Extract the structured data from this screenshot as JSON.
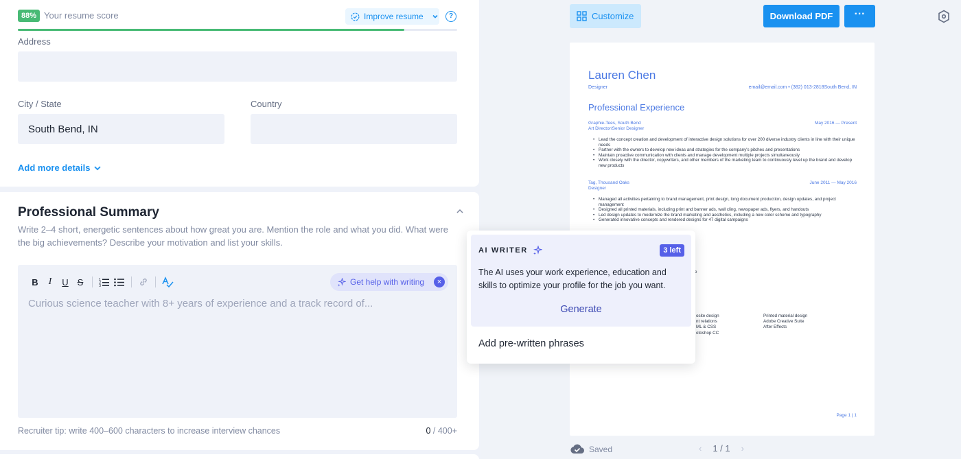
{
  "score": {
    "badge": "88%",
    "label": "Your resume score",
    "progress_percent": 88,
    "improve_label": "Improve resume",
    "help_glyph": "?"
  },
  "personal": {
    "address_label": "Address",
    "address_value": "",
    "city_label": "City / State",
    "city_value": "South Bend, IN",
    "country_label": "Country",
    "country_value": "",
    "add_more_label": "Add more details"
  },
  "summary": {
    "title": "Professional Summary",
    "description": "Write 2–4 short, energetic sentences about how great you are. Mention the role and what you did. What were the big achievements? Describe your motivation and list your skills.",
    "toolbar": {
      "bold": "B",
      "italic": "I",
      "underline": "U",
      "strike": "S"
    },
    "help_writing_label": "Get help with writing",
    "help_close_glyph": "×",
    "placeholder": "Curious science teacher with 8+ years of experience and a track record of...",
    "tip": "Recruiter tip: write 400–600 characters to increase interview chances",
    "count_current": "0",
    "count_max": " / 400+"
  },
  "preview_toolbar": {
    "customize_label": "Customize",
    "download_label": "Download PDF",
    "more_glyph": "···"
  },
  "resume": {
    "name": "Lauren Chen",
    "role": "Designer",
    "contact": "email@email.com • (382) 013-2818South Bend, IN",
    "section_experience": "Professional Experience",
    "jobs": [
      {
        "company": "Graphie-Tees, South Bend",
        "title": "Art Director/Senior Designer",
        "dates": "May 2016 — Present",
        "bullets": [
          "Lead the concept creation and development of interactive design solutions for over 200 diverse industry clients in line with their unique needs",
          "Partner with the owners to develop new ideas and strategies for the company's pitches and presentations",
          "Maintain proactive communication with clients and manage development multiple projects simultaneously",
          "Work closely with the director, copywriters, and other members of the marketing team to continuously level up the brand and develop new products"
        ]
      },
      {
        "company": "Tag, Thousand Oaks",
        "title": "Designer",
        "dates": "June 2011 — May 2016",
        "bullets": [
          "Managed all activities pertaining to brand management, print design, long document production, design updates, and project management",
          "Designed all printed materials, including print and banner ads, wall cling, newspaper ads, flyers, and handouts",
          "Led design updates to modernize the brand marketing and aesthetics, including a new color scheme and typography",
          "Generated innovative concepts and rendered designs for 47 digital campaigns"
        ]
      }
    ],
    "partial_fragment": "e",
    "skills_col1": [
      "osite design",
      "nt relations",
      "ML & CSS",
      "otoshop CC"
    ],
    "skills_col2": [
      "Printed material design",
      "Adobe Creative Suite",
      "After Effects"
    ],
    "page_label": "Page 1 | 1"
  },
  "footer": {
    "saved_label": "Saved",
    "page_indicator": "1 / 1",
    "prev_glyph": "‹",
    "next_glyph": "›"
  },
  "ai_popup": {
    "title": "AI WRITER",
    "badge": "3 left",
    "text": "The AI uses your work experience, education and skills to optimize your profile for the job you want.",
    "generate_label": "Generate",
    "prewritten_label": "Add pre-written phrases"
  },
  "colors": {
    "accent": "#1a91f0",
    "score_green": "#48ba75",
    "ai_purple": "#5660e8",
    "resume_blue": "#4a78e3"
  }
}
